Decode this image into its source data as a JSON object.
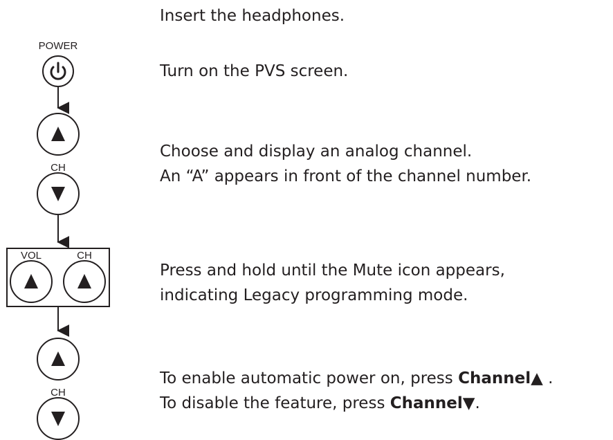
{
  "diagram": {
    "power_label": "POWER",
    "ch_label_1": "CH",
    "vol_label": "VOL",
    "ch_label_2": "CH",
    "ch_label_3": "CH"
  },
  "steps": [
    {
      "line1": "Insert the headphones."
    },
    {
      "line1": "Turn on the PVS screen."
    },
    {
      "line1": "Choose and display an analog channel.",
      "line2": "An “A” appears in front of the channel number."
    },
    {
      "line1": "Press and hold until the Mute icon appears,",
      "line2": "indicating Legacy programming mode."
    },
    {
      "line1_prefix": "To enable automatic power on, press ",
      "line1_bold": "Channel▲",
      "line1_suffix": " .",
      "line2_prefix": "To disable the feature, press ",
      "line2_bold": "Channel▼",
      "line2_suffix": "."
    }
  ],
  "icons": {
    "power": "power-icon",
    "up": "triangle-up-icon",
    "down": "triangle-down-icon",
    "arrow": "arrow-down-icon"
  }
}
